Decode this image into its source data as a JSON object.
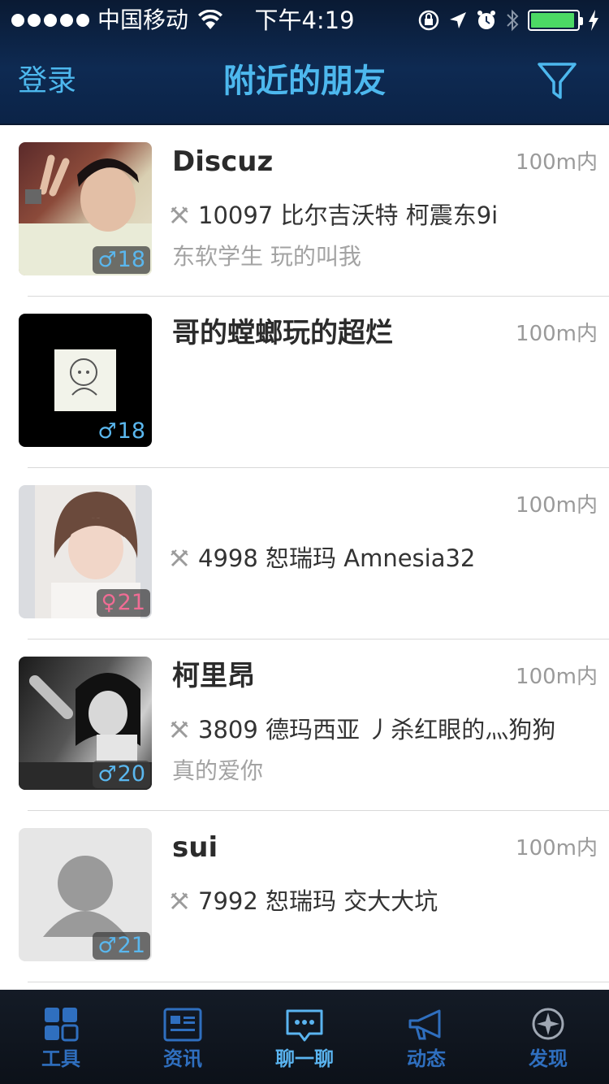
{
  "status_bar": {
    "carrier": "中国移动",
    "time": "下午4:19",
    "battery_level": 0.95
  },
  "nav": {
    "login_label": "登录",
    "title": "附近的朋友",
    "filter_icon": "filter-icon"
  },
  "friends": [
    {
      "name": "Discuz",
      "distance": "100m内",
      "gender_symbol": "♂",
      "age": "18",
      "game": "10097 比尔吉沃特 柯震东9i",
      "signature": "东软学生  玩的叫我"
    },
    {
      "name": "哥的螳螂玩的超烂",
      "distance": "100m内",
      "gender_symbol": "♂",
      "age": "18",
      "game": "",
      "signature": ""
    },
    {
      "name": "",
      "distance": "100m内",
      "gender_symbol": "♀",
      "age": "21",
      "game": "4998 恕瑞玛 Amnesia32",
      "signature": ""
    },
    {
      "name": "柯里昂",
      "distance": "100m内",
      "gender_symbol": "♂",
      "age": "20",
      "game": "3809 德玛西亚 丿杀红眼的灬狗狗",
      "signature": "真的爱你"
    },
    {
      "name": "sui",
      "distance": "100m内",
      "gender_symbol": "♂",
      "age": "21",
      "game": "7992 恕瑞玛 交大大坑",
      "signature": ""
    }
  ],
  "tabs": [
    {
      "label": "工具",
      "icon": "grid-icon"
    },
    {
      "label": "资讯",
      "icon": "news-icon"
    },
    {
      "label": "聊一聊",
      "icon": "chat-icon"
    },
    {
      "label": "动态",
      "icon": "megaphone-icon"
    },
    {
      "label": "发现",
      "icon": "compass-icon"
    }
  ],
  "colors": {
    "accent": "#4db8ee",
    "male": "#5ab7ee",
    "female": "#f06c94",
    "header_bg": "#0e2a52"
  }
}
